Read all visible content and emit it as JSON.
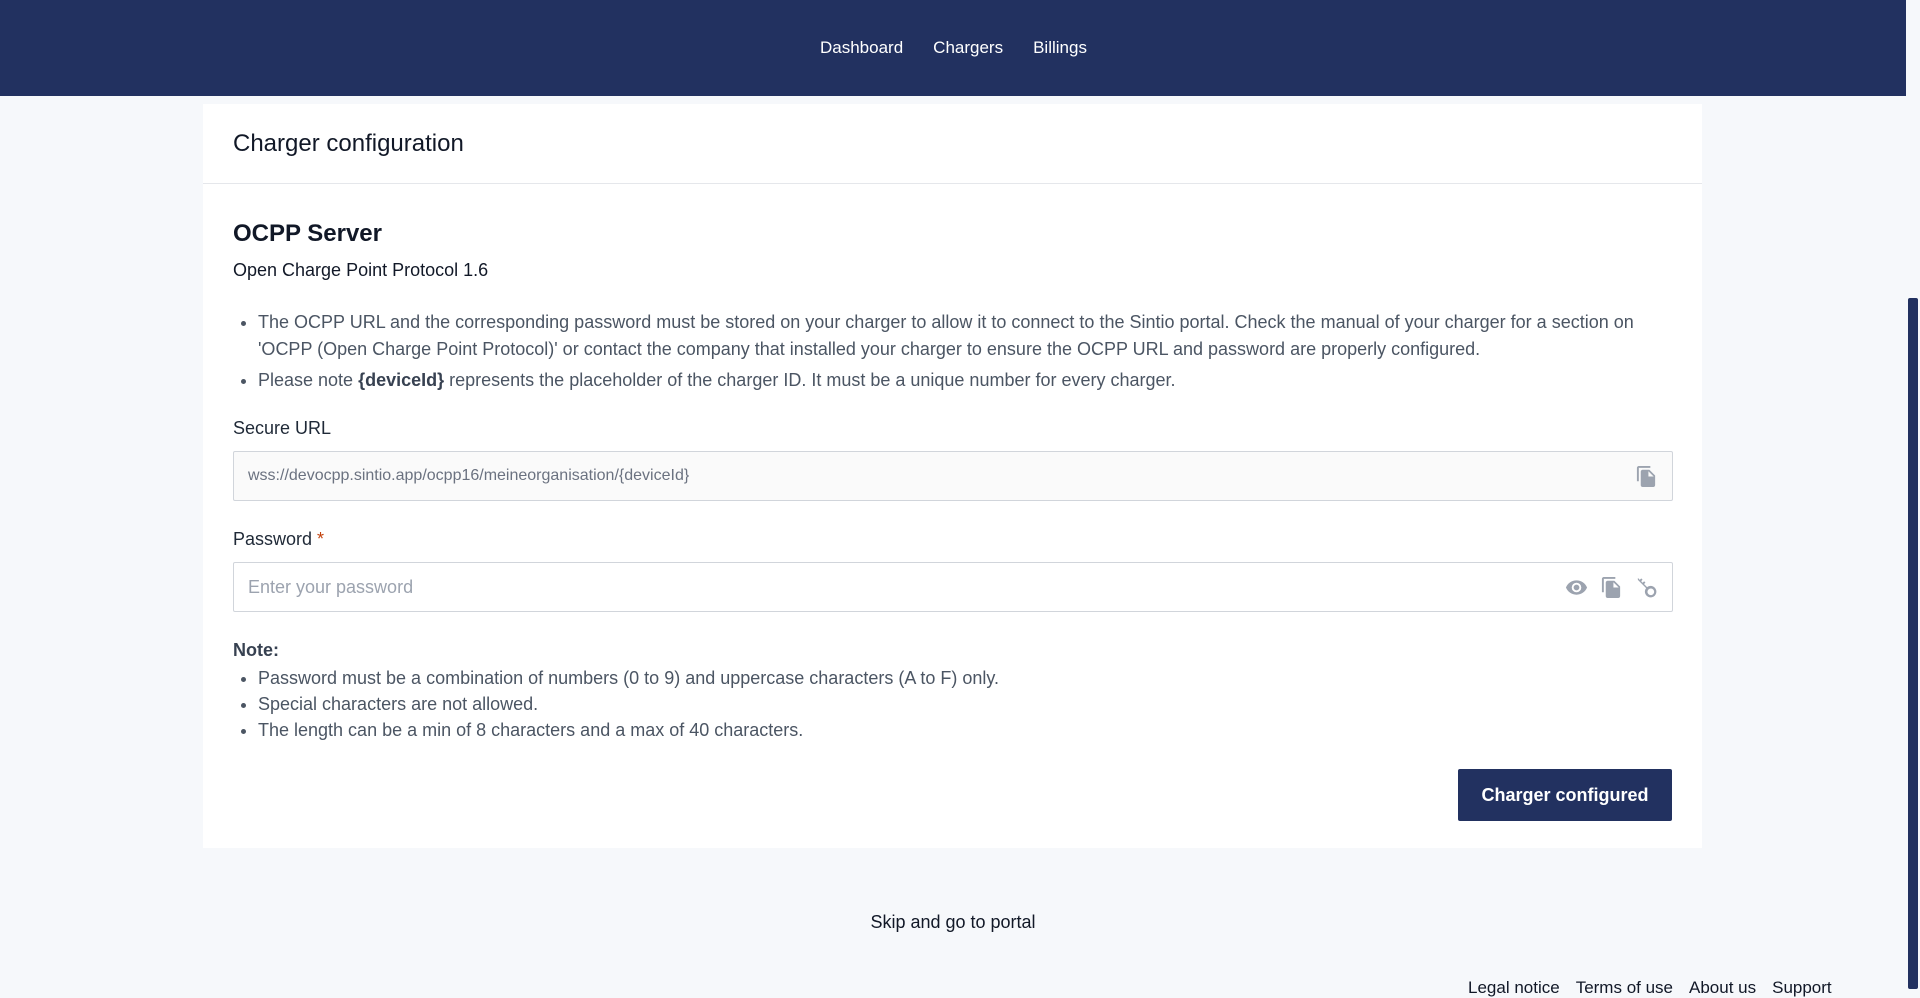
{
  "nav": {
    "items": [
      {
        "label": "Dashboard"
      },
      {
        "label": "Chargers"
      },
      {
        "label": "Billings"
      }
    ]
  },
  "card": {
    "title": "Charger configuration",
    "section_title": "OCPP Server",
    "section_subtitle": "Open Charge Point Protocol 1.6",
    "info": {
      "item1": "The OCPP URL and the corresponding password must be stored on your charger to allow it to connect to the Sintio portal. Check the manual of your charger for a section on 'OCPP (Open Charge Point Protocol)' or contact the company that installed your charger to ensure the OCPP URL and password are properly configured.",
      "item2_prefix": "Please note ",
      "item2_bold": "{deviceId}",
      "item2_suffix": " represents the placeholder of the charger ID. It must be a unique number for every charger."
    },
    "secure_url": {
      "label": "Secure URL",
      "value": "wss://devocpp.sintio.app/ocpp16/meineorganisation/{deviceId}"
    },
    "password": {
      "label": "Password",
      "required_mark": "*",
      "placeholder": "Enter your password"
    },
    "note": {
      "title": "Note:",
      "items": [
        "Password must be a combination of numbers (0 to 9) and uppercase characters (A to F) only.",
        "Special characters are not allowed.",
        "The length can be a min of 8 characters and a max of 40 characters."
      ]
    },
    "submit_label": "Charger configured"
  },
  "skip_label": "Skip and go to portal",
  "footer": {
    "links": [
      {
        "label": "Legal notice"
      },
      {
        "label": "Terms of use"
      },
      {
        "label": "About us"
      },
      {
        "label": "Support"
      }
    ]
  },
  "colors": {
    "brand": "#223160",
    "required": "#c2410c",
    "icon": "#9ca3af"
  },
  "icons": {
    "copy": "copy-icon",
    "eye": "eye-icon",
    "key": "key-icon"
  }
}
